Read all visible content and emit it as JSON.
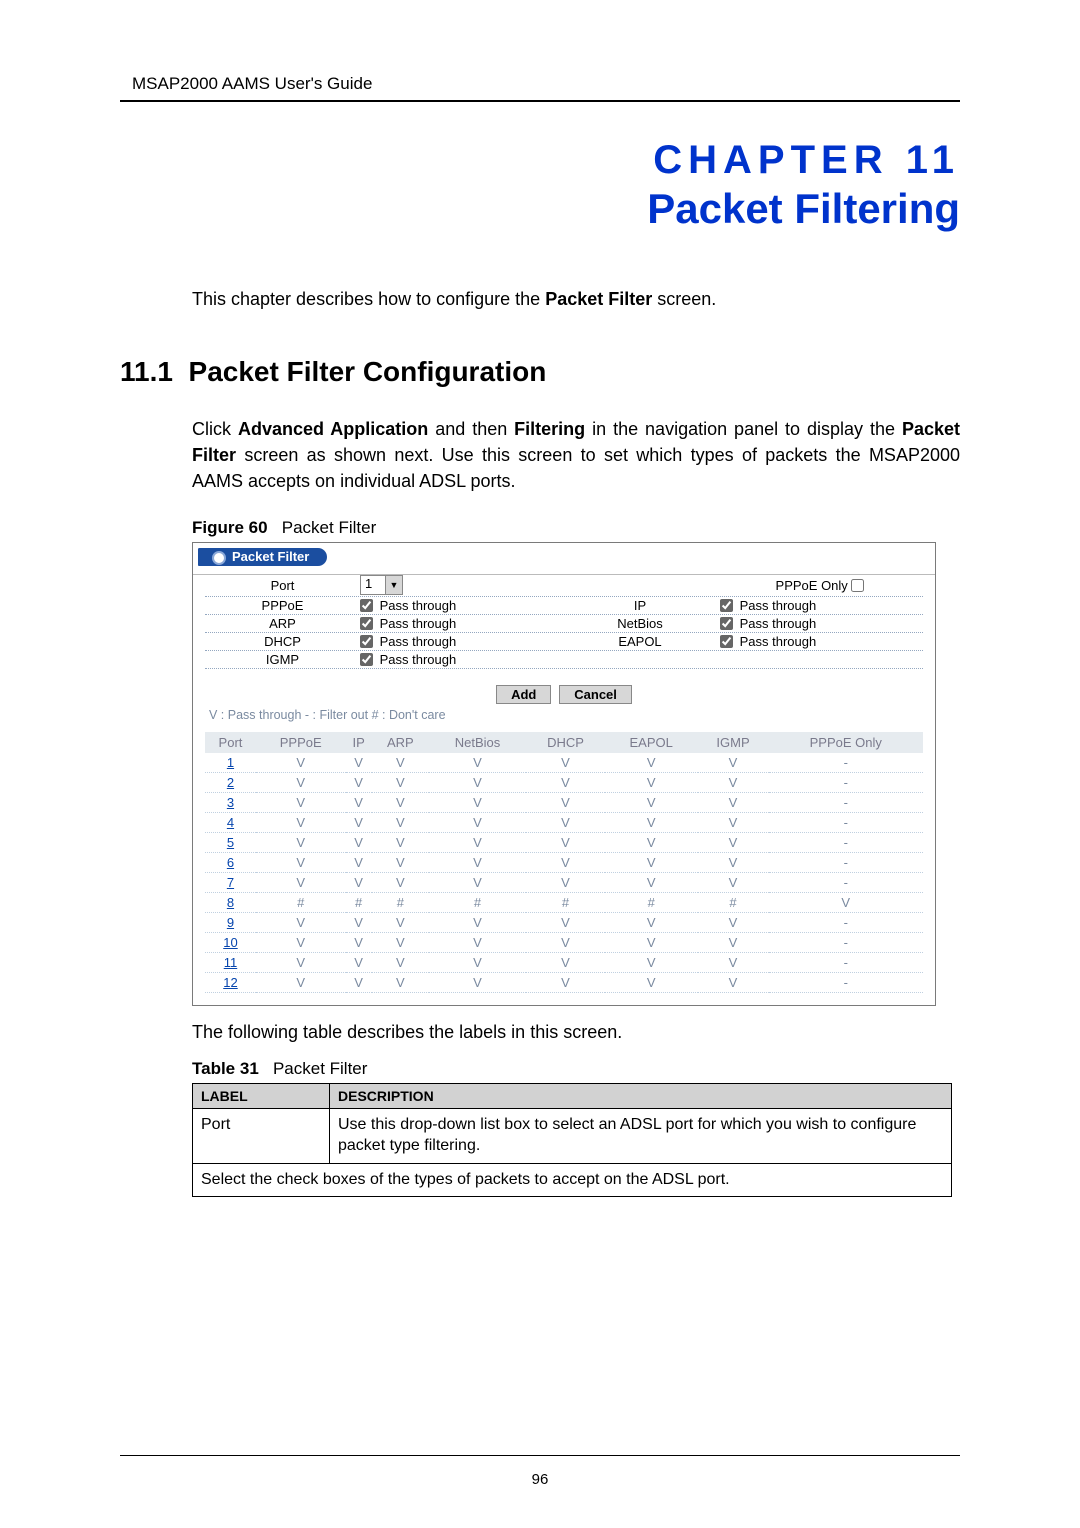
{
  "header": {
    "guide": "MSAP2000 AAMS User's Guide"
  },
  "chapter": {
    "prefix": "CHAPTER",
    "num": "11",
    "title": "Packet Filtering"
  },
  "intro": {
    "t1": "This chapter describes how to configure the ",
    "b": "Packet Filter",
    "t2": " screen."
  },
  "section": {
    "num": "11.1",
    "title": "Packet Filter Configuration",
    "body": {
      "p1a": "Click ",
      "b1": "Advanced Application",
      "p1b": " and then ",
      "b2": "Filtering",
      "p1c": " in the navigation panel to display the ",
      "b3": "Packet Filter",
      "p1d": " screen as shown next. Use this screen to set which types of packets the MSAP2000 AAMS accepts on individual ADSL ports."
    }
  },
  "fig": {
    "label": "Figure 60",
    "caption": "Packet Filter"
  },
  "form": {
    "tab": "Packet Filter",
    "port_lbl": "Port",
    "port_value": "1",
    "pppoe_only_lbl": "PPPoE Only",
    "rows": [
      {
        "ll": "PPPoE",
        "lv": "Pass through",
        "rl": "IP",
        "rv": "Pass through"
      },
      {
        "ll": "ARP",
        "lv": "Pass through",
        "rl": "NetBios",
        "rv": "Pass through"
      },
      {
        "ll": "DHCP",
        "lv": "Pass through",
        "rl": "EAPOL",
        "rv": "Pass through"
      },
      {
        "ll": "IGMP",
        "lv": "Pass through",
        "rl": "",
        "rv": ""
      }
    ],
    "add": "Add",
    "cancel": "Cancel",
    "legend": "V : Pass through    - : Filter out    # : Don't care"
  },
  "ptable": {
    "headers": [
      "Port",
      "PPPoE",
      "IP",
      "ARP",
      "NetBios",
      "DHCP",
      "EAPOL",
      "IGMP",
      "PPPoE Only"
    ],
    "rows": [
      [
        "1",
        "V",
        "V",
        "V",
        "V",
        "V",
        "V",
        "V",
        "-"
      ],
      [
        "2",
        "V",
        "V",
        "V",
        "V",
        "V",
        "V",
        "V",
        "-"
      ],
      [
        "3",
        "V",
        "V",
        "V",
        "V",
        "V",
        "V",
        "V",
        "-"
      ],
      [
        "4",
        "V",
        "V",
        "V",
        "V",
        "V",
        "V",
        "V",
        "-"
      ],
      [
        "5",
        "V",
        "V",
        "V",
        "V",
        "V",
        "V",
        "V",
        "-"
      ],
      [
        "6",
        "V",
        "V",
        "V",
        "V",
        "V",
        "V",
        "V",
        "-"
      ],
      [
        "7",
        "V",
        "V",
        "V",
        "V",
        "V",
        "V",
        "V",
        "-"
      ],
      [
        "8",
        "#",
        "#",
        "#",
        "#",
        "#",
        "#",
        "#",
        "V"
      ],
      [
        "9",
        "V",
        "V",
        "V",
        "V",
        "V",
        "V",
        "V",
        "-"
      ],
      [
        "10",
        "V",
        "V",
        "V",
        "V",
        "V",
        "V",
        "V",
        "-"
      ],
      [
        "11",
        "V",
        "V",
        "V",
        "V",
        "V",
        "V",
        "V",
        "-"
      ],
      [
        "12",
        "V",
        "V",
        "V",
        "V",
        "V",
        "V",
        "V",
        "-"
      ]
    ]
  },
  "after_fig": "The following table describes the labels in this screen.",
  "table31": {
    "label": "Table 31",
    "caption": "Packet Filter",
    "th1": "LABEL",
    "th2": "DESCRIPTION",
    "r1": {
      "label": "Port",
      "desc": "Use this drop-down list box to select an ADSL port for which you wish to configure packet type filtering."
    },
    "r2": "Select the check boxes of the types of packets to accept on the ADSL port."
  },
  "page_no": "96"
}
